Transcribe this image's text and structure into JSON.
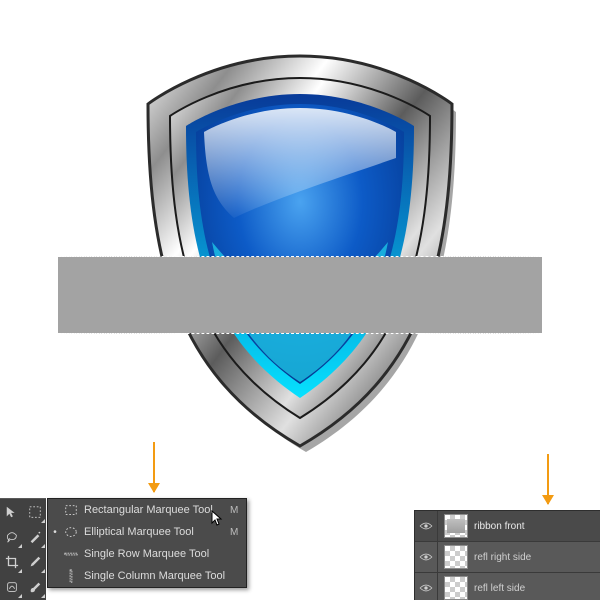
{
  "flyout": {
    "items": [
      {
        "label": "Rectangular Marquee Tool",
        "shortcut": "M",
        "active": true,
        "icon": "rect-marquee-icon"
      },
      {
        "label": "Elliptical Marquee Tool",
        "shortcut": "M",
        "active": false,
        "icon": "ellipse-marquee-icon"
      },
      {
        "label": "Single Row Marquee Tool",
        "shortcut": "",
        "active": false,
        "icon": "row-marquee-icon"
      },
      {
        "label": "Single Column Marquee Tool",
        "shortcut": "",
        "active": false,
        "icon": "col-marquee-icon"
      }
    ]
  },
  "layers": {
    "items": [
      {
        "name": "ribbon front",
        "visible": true,
        "selected": true
      },
      {
        "name": "refl right side",
        "visible": true,
        "selected": false
      },
      {
        "name": "refl left side",
        "visible": true,
        "selected": false
      }
    ]
  },
  "colors": {
    "annotation_arrow": "#f39b12",
    "selection_fill": "#a3a3a3",
    "panel_bg": "#4b4b4b"
  }
}
